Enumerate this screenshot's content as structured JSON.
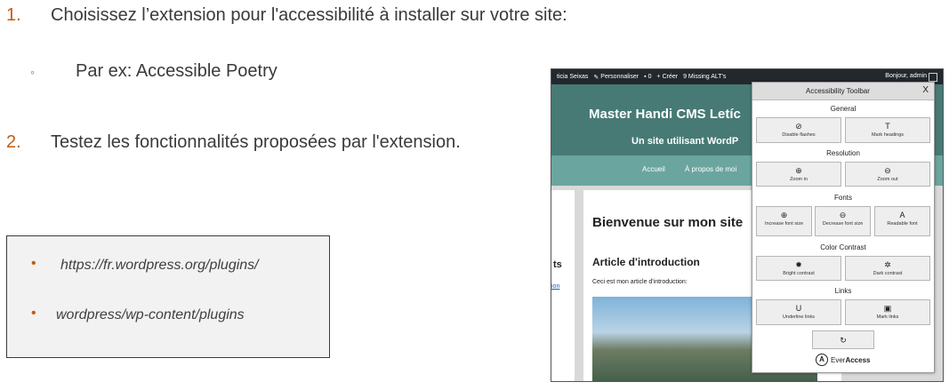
{
  "slide": {
    "step1_num": "1.",
    "step1_text": "Choisissez l’extension pour l'accessibilité à installer sur votre site:",
    "sub_bullet": "◦",
    "sub_text": "Par ex: Accessible Poetry",
    "step2_num": "2.",
    "step2_text": "Testez les fonctionnalités proposées par l'extension.",
    "box": {
      "bullet": "•",
      "items": [
        "https://fr.wordpress.org/plugins/",
        "wordpress/wp-content/plugins"
      ]
    }
  },
  "screenshot": {
    "adminbar": {
      "site": "ticia Seixas",
      "customize": "Personnaliser",
      "comments": "0",
      "new": "Créer",
      "missing": "9 Missing ALT's",
      "greeting": "Bonjour, admin"
    },
    "site_title": "Master Handi CMS Letíc",
    "tagline": "Un site utilisant WordP",
    "nav": [
      "Accueil",
      "À propos de moi"
    ],
    "welcome": "Bienvenue sur mon site",
    "article_title": "Article d'introduction",
    "article_line": "Ceci est mon article d'introduction:",
    "left_title": "ts",
    "left_link": "ion"
  },
  "toolbar": {
    "title": "Accessibility Toolbar",
    "close": "X",
    "sections": {
      "general": "General",
      "resolution": "Resolution",
      "fonts": "Fonts",
      "contrast": "Color Contrast",
      "links": "Links"
    },
    "buttons": {
      "disable_flashes": "Disable flashes",
      "mark_headings": "Mark headings",
      "zoom_in": "Zoom in",
      "zoom_out": "Zoom out",
      "increase_font": "Increase font size",
      "decrease_font": "Decrease font size",
      "readable_font": "Readable font",
      "bright_contrast": "Bright contrast",
      "dark_contrast": "Dark contrast",
      "underline_links": "Underline links",
      "mark_links": "Mark links"
    },
    "brand_prefix": "Ever",
    "brand_bold": "Access",
    "logo_letter": "A"
  }
}
